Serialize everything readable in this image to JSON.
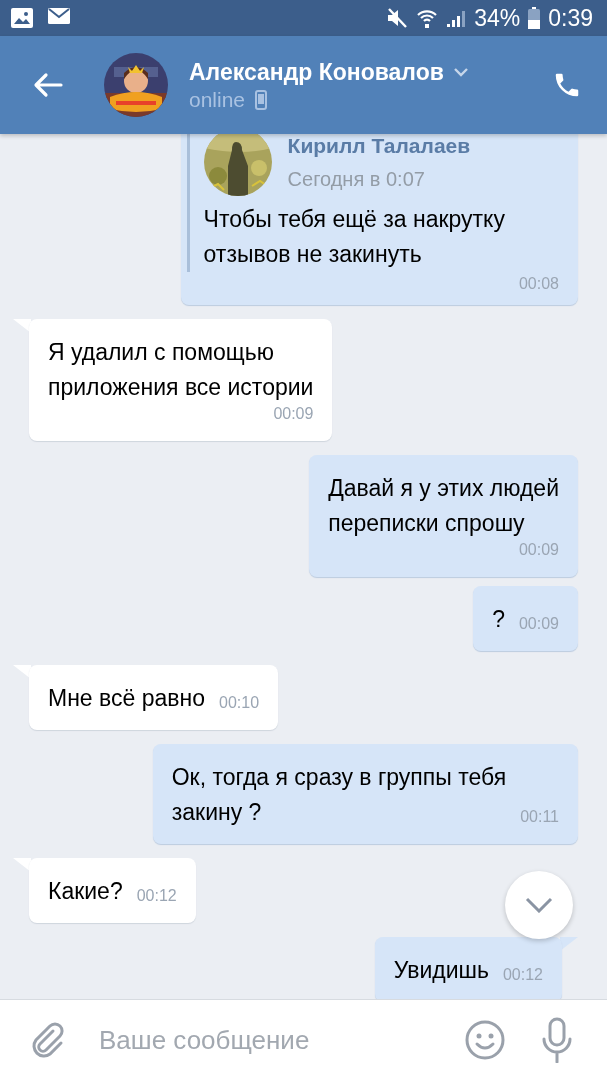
{
  "status_bar": {
    "battery": "34%",
    "time": "0:39"
  },
  "header": {
    "name": "Александр Коновалов",
    "status": "online"
  },
  "messages": [
    {
      "kind": "forwarded",
      "tail": false,
      "forward": {
        "author": "Кирилл Талалаев",
        "date": "Сегодня в 0:07",
        "text": "Чтобы тебя ещё за накрутку\nотзывов не закинуть"
      },
      "time": "00:08"
    },
    {
      "kind": "received",
      "tail": true,
      "text": "Я удалил с помощью\nприложения все истории",
      "time": "00:09"
    },
    {
      "kind": "sent",
      "tail": false,
      "text": "Давай я у этих людей\nпереписки спрошу",
      "time": "00:09"
    },
    {
      "kind": "sent",
      "tail": false,
      "text": "?",
      "time": "00:09"
    },
    {
      "kind": "received",
      "tail": true,
      "text": "Мне всё равно",
      "time": "00:10"
    },
    {
      "kind": "sent",
      "tail": false,
      "text": "Ок, тогда я сразу в группы тебя\nзакину ?",
      "time": "00:11"
    },
    {
      "kind": "received",
      "tail": true,
      "text": "Какие?",
      "time": "00:12"
    },
    {
      "kind": "sent",
      "tail": true,
      "text": "Увидишь",
      "time": "00:12"
    }
  ],
  "composer": {
    "placeholder": "Ваше сообщение"
  }
}
